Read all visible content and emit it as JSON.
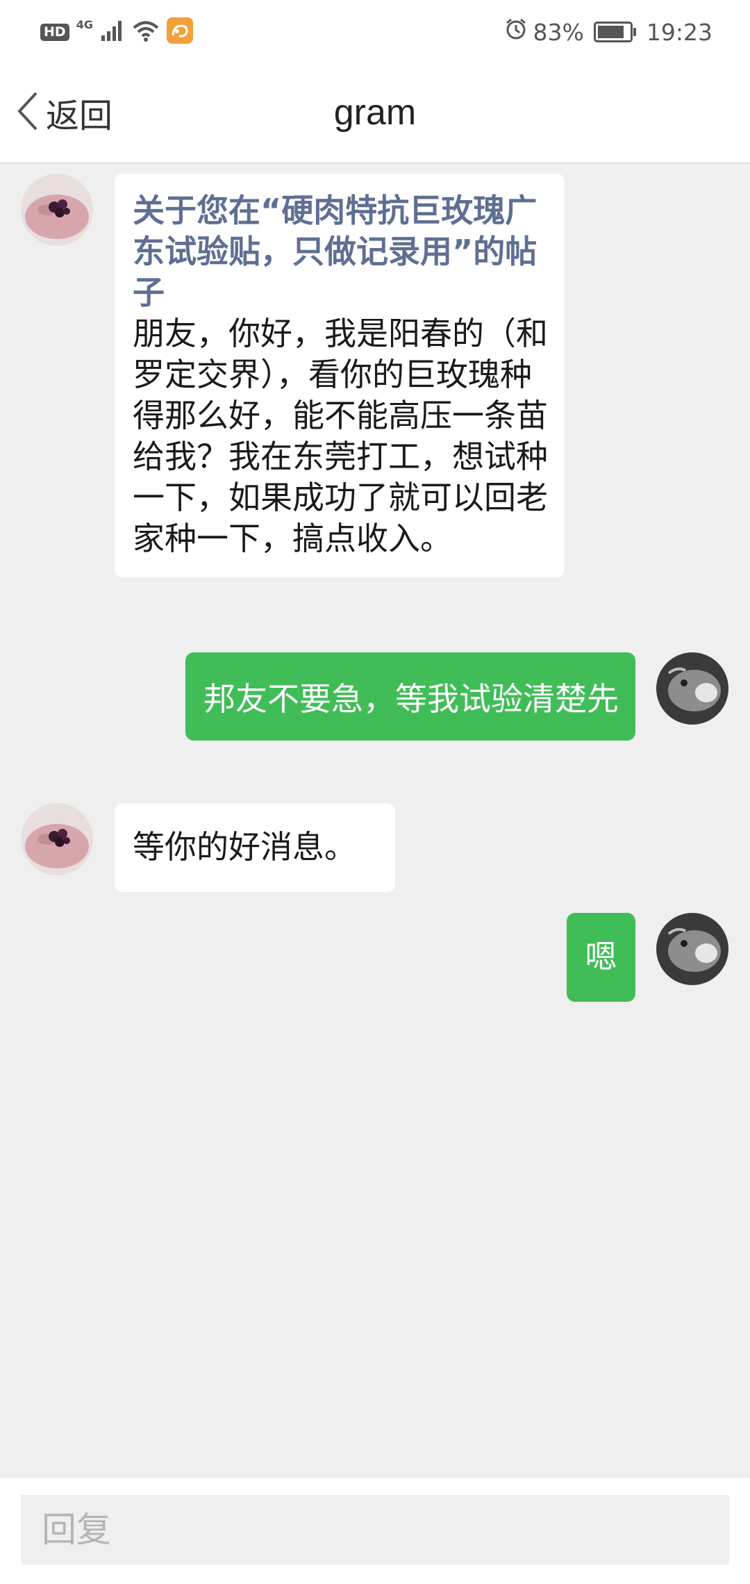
{
  "status_bar": {
    "hd": "HD",
    "network": "4G",
    "battery_percent": "83%",
    "battery_level": 0.83,
    "time": "19:23",
    "icons": [
      "signal-icon",
      "wifi-icon",
      "uc-browser-icon",
      "alarm-icon",
      "battery-icon"
    ]
  },
  "nav": {
    "back_label": "返回",
    "title": "gram"
  },
  "messages": [
    {
      "direction": "incoming",
      "topic": "关于您在“硬肉特抗巨玫瑰广东试验贴，只做记录用”的帖子",
      "text": "朋友，你好，我是阳春的（和罗定交界），看你的巨玫瑰种得那么好，能不能高压一条苗给我？我在东莞打工，想试种一下，如果成功了就可以回老家种一下，搞点收入。"
    },
    {
      "direction": "outgoing",
      "text": "邦友不要急，等我试验清楚先"
    },
    {
      "direction": "incoming",
      "text": "等你的好消息。"
    },
    {
      "direction": "outgoing",
      "text": "嗯"
    }
  ],
  "reply": {
    "placeholder": "回复"
  },
  "colors": {
    "outgoing_bubble": "#41bd58",
    "incoming_bubble": "#ffffff",
    "topic_text": "#5f6f93",
    "background": "#efefef"
  }
}
